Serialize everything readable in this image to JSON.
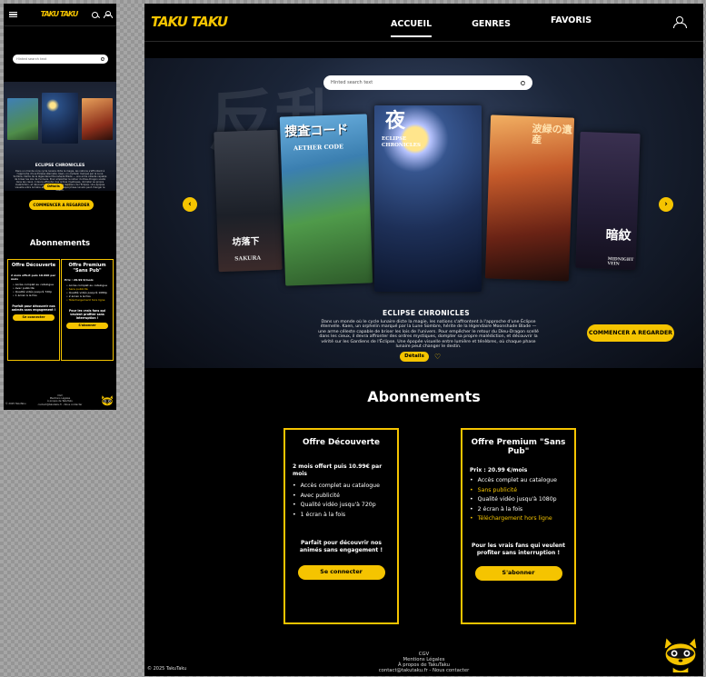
{
  "brand": {
    "logo": "TAKU TAKU",
    "accent": "#f5c400"
  },
  "nav": {
    "items": [
      "ACCUEIL",
      "GENRES",
      "FAVORIS"
    ],
    "active": "ACCUEIL"
  },
  "search": {
    "placeholder": "Hinted search text"
  },
  "hero": {
    "covers": [
      {
        "title": "坊落下",
        "subtitle": "SAKURA"
      },
      {
        "title": "捜査コード",
        "subtitle": "AETHER CODE"
      },
      {
        "title": "夜",
        "subtitle": "ECLIPSE CHRONICLES"
      },
      {
        "title": "波緑の遺産",
        "subtitle": ""
      },
      {
        "title": "暗紋",
        "subtitle": "MIDNIGHT VEIN"
      }
    ],
    "title": "ECLIPSE CHRONICLES",
    "description": "Dans un monde où le cycle lunaire dicte la magie, les nations s'affrontent à l'approche d'une Éclipse éternelle. Kaen, un orphelin marqué par la Lune Sombre, hérite de la légendaire Moonshade Blade — une arme céleste capable de briser les lois de l'univers. Pour empêcher le retour du Dieu-Dragon scellé dans les cieux, il devra affronter des ordres mystiques, dompter sa propre malédiction, et découvrir la vérité sur les Gardiens de l'Éclipse. Une épopée visuelle entre lumière et ténèbres, où chaque phase lunaire peut changer le destin.",
    "details_label": "Détails",
    "cta_label": "COMMENCER A REGARDER"
  },
  "subscriptions": {
    "title": "Abonnements",
    "plans": [
      {
        "name": "Offre Découverte",
        "price_line": "2 mois offert puis 10.99€ par mois",
        "features": [
          "Accès complet au catalogue",
          "Avec publicité",
          "Qualité vidéo jusqu'à 720p",
          "1 écran à la fois"
        ],
        "tagline": "Parfait pour découvrir nos animés sans engagement !",
        "button": "Se connecter"
      },
      {
        "name": "Offre Premium \"Sans Pub\"",
        "price_line": "Prix : 20.99 €/mois",
        "features": [
          "Accès complet au catalogue",
          "Sans publicité",
          "Qualité vidéo jusqu'à 1080p",
          "2 écran à la fois",
          "Téléchargement hors ligne"
        ],
        "tagline": "Pour les vrais fans qui veulent profiter sans interruption !",
        "button": "S'abonner"
      }
    ]
  },
  "footer": {
    "links": [
      "CGV",
      "Mentions Légales",
      "À propos de TakuTaku",
      "contact@takutaku.fr - Nous contacter"
    ],
    "copyright": "© 2025 TakuTaku"
  }
}
